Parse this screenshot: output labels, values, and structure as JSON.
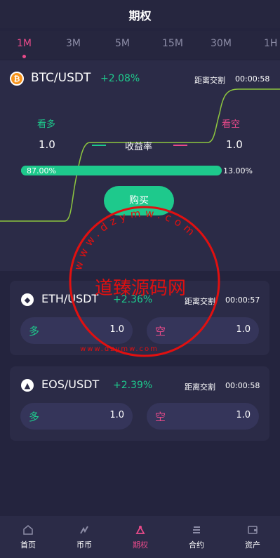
{
  "header": {
    "title": "期权"
  },
  "tabs": [
    {
      "label": "1M",
      "active": true
    },
    {
      "label": "3M",
      "active": false
    },
    {
      "label": "5M",
      "active": false
    },
    {
      "label": "15M",
      "active": false
    },
    {
      "label": "30M",
      "active": false
    },
    {
      "label": "1H",
      "active": false
    }
  ],
  "main": {
    "pair": "BTC/USDT",
    "change": "+2.08%",
    "countdown_label": "距离交割",
    "countdown": "00:00:58",
    "long_label": "看多",
    "short_label": "看空",
    "long_value": "1.0",
    "short_value": "1.0",
    "yield_label": "收益率",
    "long_ratio": "87.00%",
    "short_ratio": "13.00%",
    "long_ratio_fraction": 0.87,
    "buy_label": "购买"
  },
  "cards": [
    {
      "pair": "ETH/USDT",
      "change": "+2.36%",
      "countdown_label": "距离交割",
      "countdown": "00:00:57",
      "long_label": "多",
      "long_amount": "1.0",
      "short_label": "空",
      "short_amount": "1.0"
    },
    {
      "pair": "EOS/USDT",
      "change": "+2.39%",
      "countdown_label": "距离交割",
      "countdown": "00:00:58",
      "long_label": "多",
      "long_amount": "1.0",
      "short_label": "空",
      "short_amount": "1.0"
    }
  ],
  "watermark": {
    "title": "道臻源码网",
    "ring_text": "www.dzymw.com"
  },
  "nav": [
    {
      "label": "首页",
      "icon": "home-icon",
      "active": false
    },
    {
      "label": "币币",
      "icon": "exchange-icon",
      "active": false
    },
    {
      "label": "期权",
      "icon": "options-icon",
      "active": true
    },
    {
      "label": "合约",
      "icon": "contract-icon",
      "active": false
    },
    {
      "label": "资产",
      "icon": "wallet-icon",
      "active": false
    }
  ],
  "colors": {
    "up": "#1ec98c",
    "down": "#e94a8a",
    "background": "#24243e",
    "card": "#2b2b47"
  }
}
